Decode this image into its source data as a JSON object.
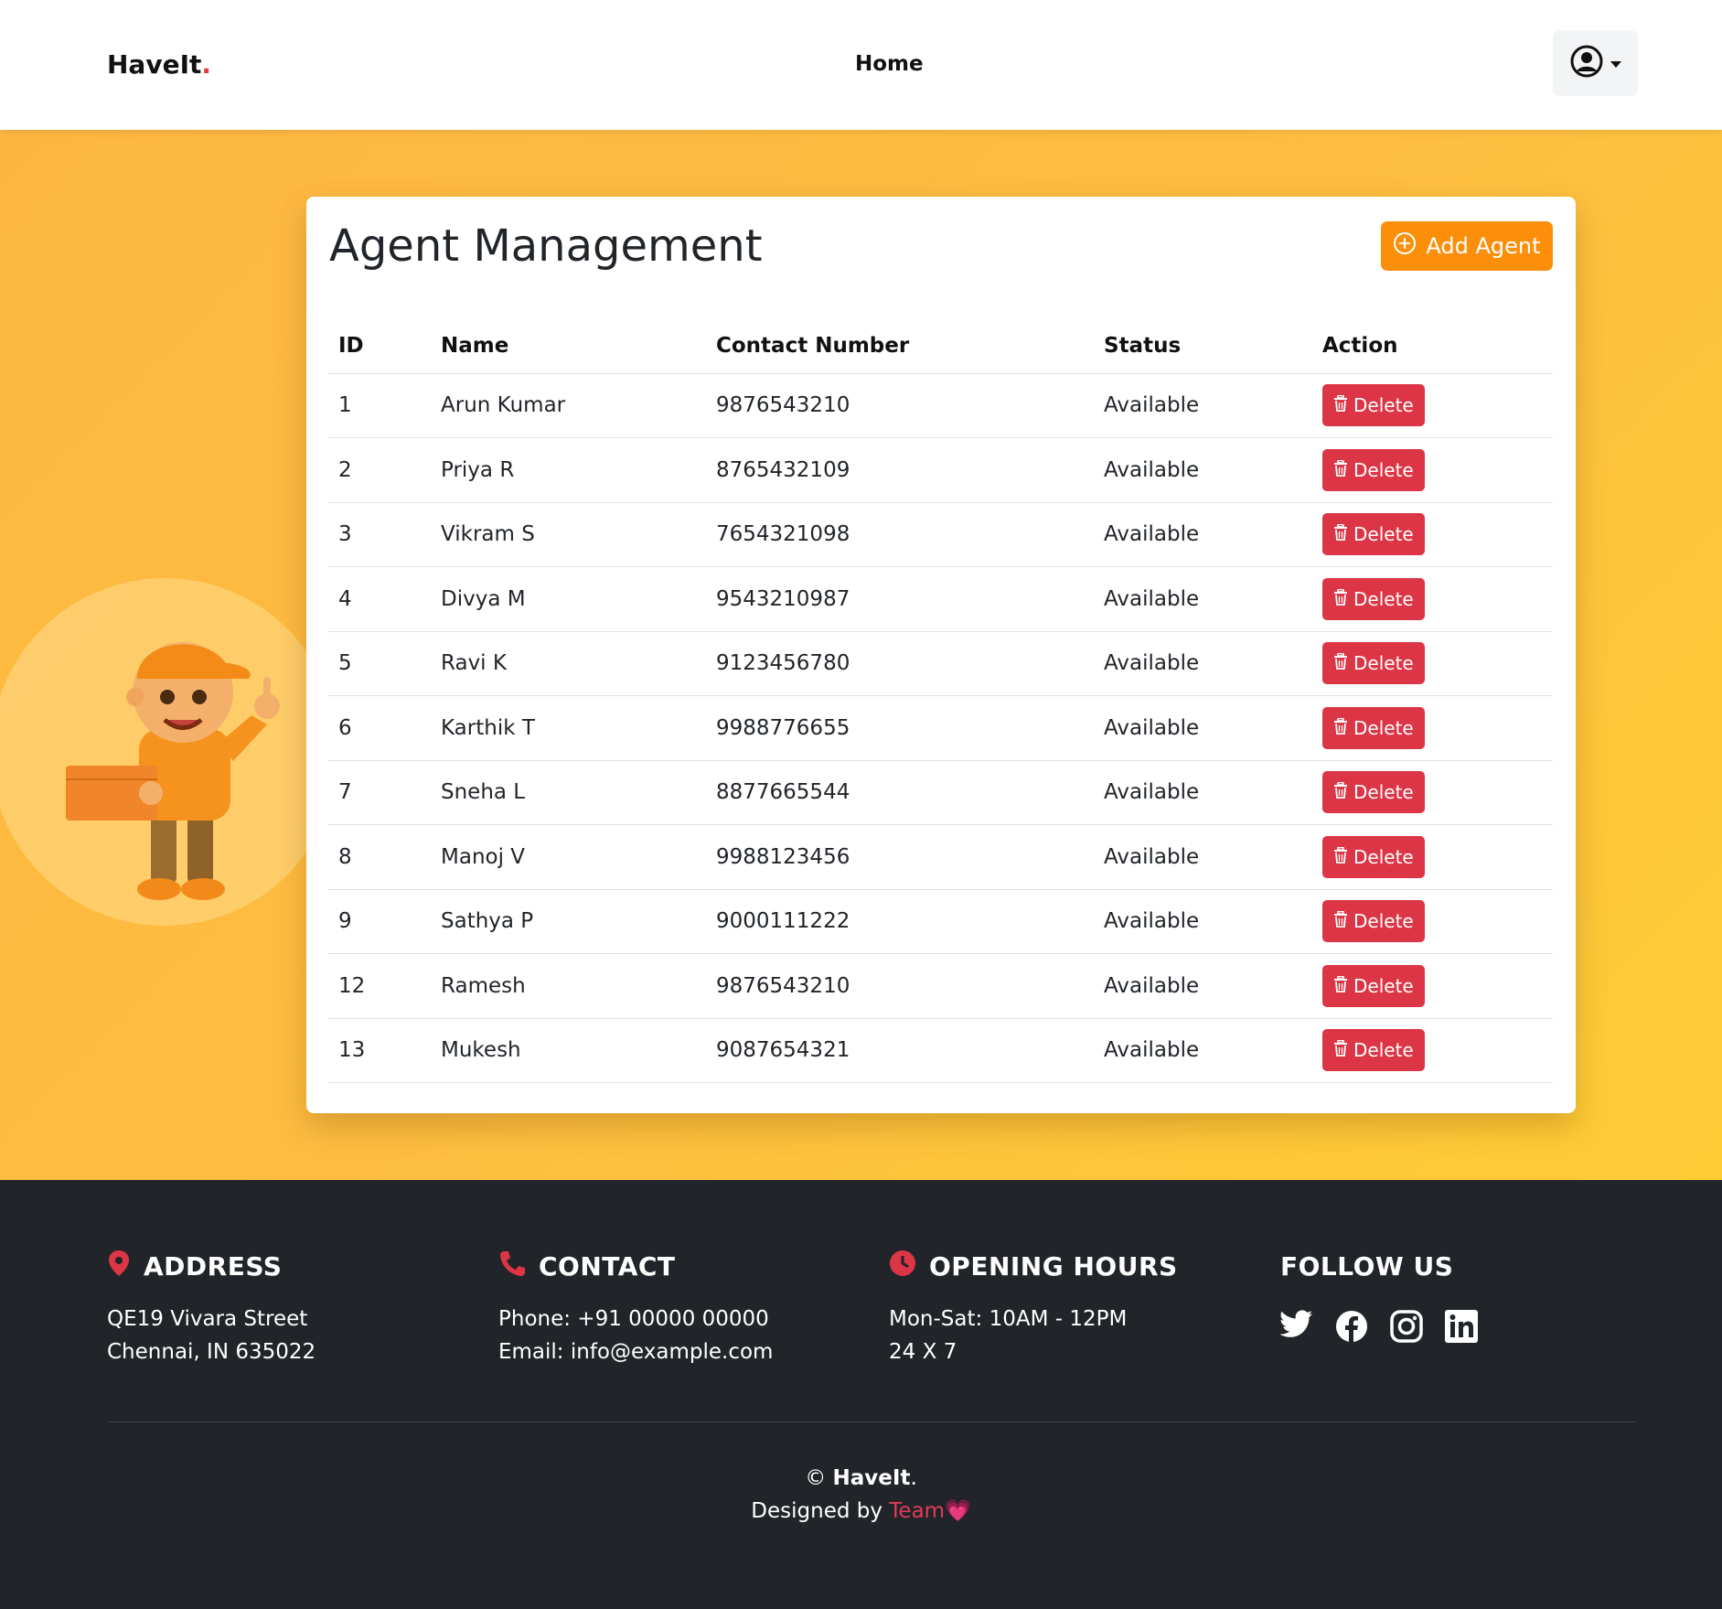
{
  "header": {
    "logo_text": "HaveIt",
    "logo_dot": ".",
    "nav_home": "Home",
    "user_icon": "user-circle-icon",
    "caret_icon": "caret-down-icon"
  },
  "page": {
    "title": "Agent Management",
    "add_button_label": "Add Agent",
    "add_icon": "plus-circle-icon"
  },
  "table": {
    "headers": [
      "ID",
      "Name",
      "Contact Number",
      "Status",
      "Action"
    ],
    "delete_label": "Delete",
    "rows": [
      {
        "id": "1",
        "name": "Arun Kumar",
        "contact": "9876543210",
        "status": "Available"
      },
      {
        "id": "2",
        "name": "Priya R",
        "contact": "8765432109",
        "status": "Available"
      },
      {
        "id": "3",
        "name": "Vikram S",
        "contact": "7654321098",
        "status": "Available"
      },
      {
        "id": "4",
        "name": "Divya M",
        "contact": "9543210987",
        "status": "Available"
      },
      {
        "id": "5",
        "name": "Ravi K",
        "contact": "9123456780",
        "status": "Available"
      },
      {
        "id": "6",
        "name": "Karthik T",
        "contact": "9988776655",
        "status": "Available"
      },
      {
        "id": "7",
        "name": "Sneha L",
        "contact": "8877665544",
        "status": "Available"
      },
      {
        "id": "8",
        "name": "Manoj V",
        "contact": "9988123456",
        "status": "Available"
      },
      {
        "id": "9",
        "name": "Sathya P",
        "contact": "9000111222",
        "status": "Available"
      },
      {
        "id": "12",
        "name": "Ramesh",
        "contact": "9876543210",
        "status": "Available"
      },
      {
        "id": "13",
        "name": "Mukesh",
        "contact": "9087654321",
        "status": "Available"
      }
    ]
  },
  "footer": {
    "address": {
      "title": "ADDRESS",
      "line1": "QE19 Vivara Street",
      "line2": "Chennai, IN 635022"
    },
    "contact": {
      "title": "CONTACT",
      "line1": "Phone: +91 00000 00000",
      "line2": "Email: info@example.com"
    },
    "hours": {
      "title": "OPENING HOURS",
      "line1": "Mon-Sat: 10AM - 12PM",
      "line2": "24 X 7"
    },
    "follow": {
      "title": "FOLLOW US",
      "icons": [
        "twitter-icon",
        "facebook-icon",
        "instagram-icon",
        "linkedin-icon"
      ]
    },
    "copyright_symbol": "©",
    "brand": "HaveIt",
    "brand_dot": ".",
    "designed_by": "Designed by",
    "team": "Team",
    "heart": "💗"
  },
  "colors": {
    "accent_orange": "#fb8f0a",
    "danger_red": "#dc3545",
    "footer_bg": "#212529",
    "bg_yellow": "#febd40"
  }
}
